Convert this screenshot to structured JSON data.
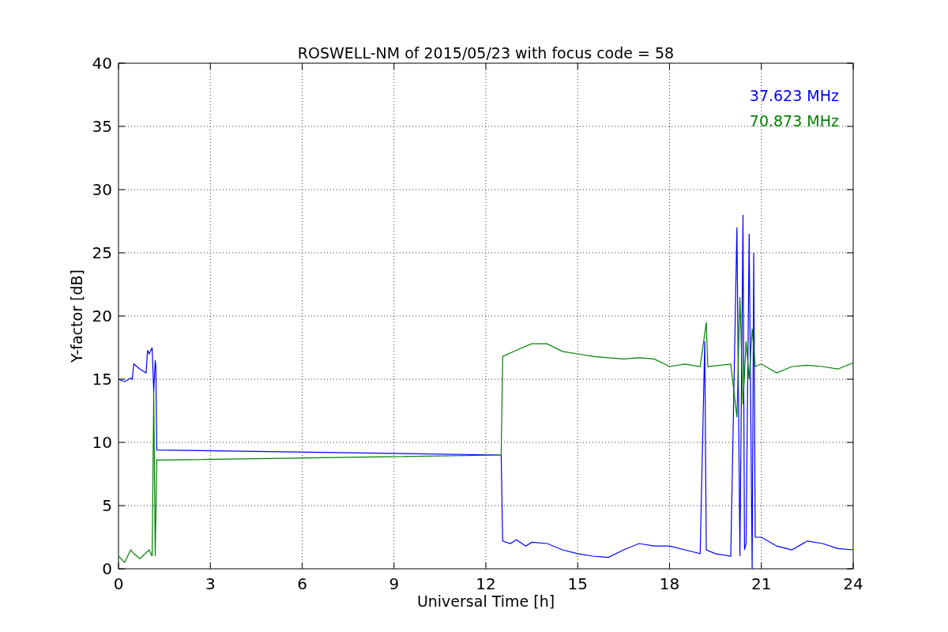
{
  "chart_data": {
    "type": "line",
    "title": "ROSWELL-NM of 2015/05/23 with focus code = 58",
    "xlabel": "Universal Time [h]",
    "ylabel": "Y-factor [dB]",
    "xlim": [
      0,
      24
    ],
    "ylim": [
      0,
      40
    ],
    "grid": true,
    "xticks": [
      0,
      3,
      6,
      9,
      12,
      15,
      18,
      21,
      24
    ],
    "yticks": [
      0,
      5,
      10,
      15,
      20,
      25,
      30,
      35,
      40
    ],
    "series": [
      {
        "name": "37.623 MHz",
        "color": "#0000ff",
        "x": [
          0,
          0.2,
          0.4,
          0.45,
          0.5,
          0.7,
          0.9,
          0.95,
          1.0,
          1.1,
          1.15,
          1.2,
          1.22,
          1.25,
          12.5,
          12.55,
          12.8,
          13,
          13.3,
          13.5,
          14,
          14.5,
          15,
          15.5,
          16,
          16.5,
          17,
          17.5,
          18,
          18.5,
          19,
          19.15,
          19.2,
          19.5,
          20,
          20.2,
          20.3,
          20.4,
          20.45,
          20.5,
          20.6,
          20.7,
          20.75,
          20.8,
          21,
          21.5,
          22,
          22.5,
          23,
          23.5,
          24
        ],
        "values": [
          15,
          14.8,
          15.1,
          15,
          16.2,
          15.8,
          15.5,
          17.3,
          17,
          17.5,
          14,
          16.5,
          16,
          9.4,
          9.0,
          2.2,
          2,
          2.3,
          1.8,
          2.1,
          2,
          1.5,
          1.2,
          1,
          0.9,
          1.5,
          2,
          1.8,
          1.8,
          1.5,
          1.2,
          18,
          1.5,
          1.2,
          1,
          27,
          1,
          28,
          1.5,
          2,
          26.5,
          0,
          25,
          2.5,
          2.5,
          1.8,
          1.5,
          2.2,
          2,
          1.6,
          1.5
        ]
      },
      {
        "name": "70.873 MHz",
        "color": "#008000",
        "x": [
          0,
          0.2,
          0.4,
          0.5,
          0.7,
          1.0,
          1.1,
          1.12,
          1.15,
          1.2,
          1.25,
          12.5,
          12.55,
          13,
          13.5,
          14,
          14.5,
          15,
          15.5,
          16,
          16.5,
          17,
          17.5,
          18,
          18.5,
          19,
          19.2,
          19.25,
          20,
          20.2,
          20.3,
          20.4,
          20.5,
          20.6,
          20.7,
          20.8,
          21,
          21.5,
          22,
          22.5,
          23,
          23.5,
          24
        ],
        "values": [
          1,
          0.5,
          1.5,
          1.2,
          0.8,
          1.5,
          1,
          5.8,
          14,
          1,
          8.6,
          9,
          16.8,
          17.3,
          17.8,
          17.8,
          17.2,
          17,
          16.8,
          16.7,
          16.6,
          16.7,
          16.6,
          16,
          16.2,
          16,
          19.5,
          16,
          16.2,
          12,
          21.5,
          13,
          18,
          15,
          19,
          16,
          16.2,
          15.5,
          16,
          16.1,
          16,
          15.8,
          16.3
        ]
      }
    ]
  }
}
